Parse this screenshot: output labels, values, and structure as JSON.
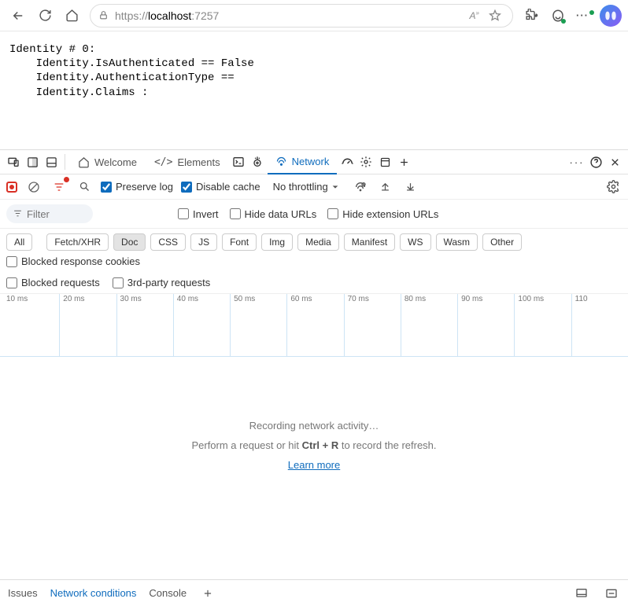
{
  "browser": {
    "url_prefix": "https://",
    "url_host": "localhost",
    "url_port": ":7257"
  },
  "page_content": "Identity # 0:\n    Identity.IsAuthenticated == False\n    Identity.AuthenticationType ==\n    Identity.Claims :",
  "devtools": {
    "tabs": {
      "welcome": "Welcome",
      "elements": "Elements",
      "network": "Network"
    }
  },
  "network_toolbar": {
    "preserve_log": "Preserve log",
    "disable_cache": "Disable cache",
    "throttling": "No throttling"
  },
  "filter_bar": {
    "filter_placeholder": "Filter",
    "invert": "Invert",
    "hide_data_urls": "Hide data URLs",
    "hide_ext_urls": "Hide extension URLs",
    "blocked_cookies": "Blocked response cookies",
    "blocked_requests": "Blocked requests",
    "third_party": "3rd-party requests",
    "types": {
      "all": "All",
      "fetch": "Fetch/XHR",
      "doc": "Doc",
      "css": "CSS",
      "js": "JS",
      "font": "Font",
      "img": "Img",
      "media": "Media",
      "manifest": "Manifest",
      "ws": "WS",
      "wasm": "Wasm",
      "other": "Other"
    }
  },
  "timeline": {
    "ticks": [
      "10 ms",
      "20 ms",
      "30 ms",
      "40 ms",
      "50 ms",
      "60 ms",
      "70 ms",
      "80 ms",
      "90 ms",
      "100 ms",
      "110"
    ]
  },
  "empty_state": {
    "line1": "Recording network activity…",
    "line2_pre": "Perform a request or hit ",
    "line2_kbd": "Ctrl + R",
    "line2_post": " to record the refresh.",
    "link": "Learn more"
  },
  "drawer": {
    "issues": "Issues",
    "network_conditions": "Network conditions",
    "console": "Console"
  }
}
